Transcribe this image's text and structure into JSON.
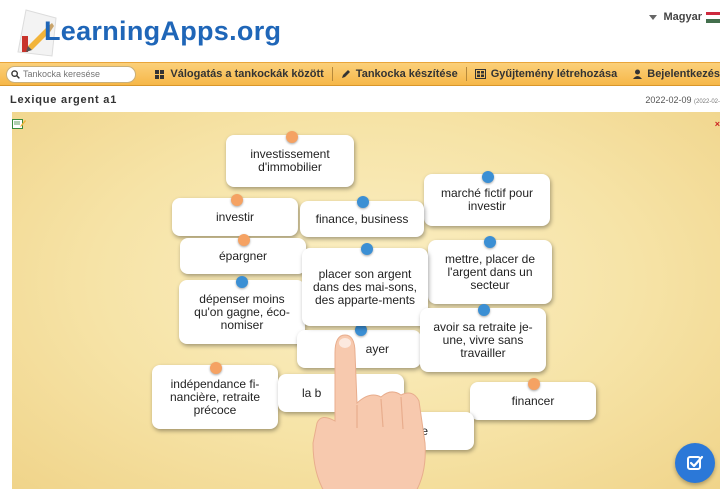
{
  "header": {
    "logo_text": "LearningApps.org",
    "language": "Magyar",
    "flag_colors": [
      "#cd2a3e",
      "#ffffff",
      "#436f4d"
    ]
  },
  "nav": {
    "search_placeholder": "Tankocka keresése",
    "items": [
      {
        "icon": "grid-icon",
        "label": "Válogatás a tankockák között"
      },
      {
        "icon": "pencil-icon",
        "label": "Tankocka készítése"
      },
      {
        "icon": "collection-icon",
        "label": "Gyűjtemény létrehozása"
      },
      {
        "icon": "user-icon",
        "label": "Bejelentkezés"
      }
    ]
  },
  "app": {
    "title": "Lexique argent a1",
    "date": "2022-02-09",
    "date_small": "(2022-02-"
  },
  "cards": [
    {
      "text": "investissement d'immobilier",
      "pin": "orange"
    },
    {
      "text": "marché fictif pour investir",
      "pin": "blue"
    },
    {
      "text": "investir",
      "pin": "orange"
    },
    {
      "text": "finance, business",
      "pin": "blue"
    },
    {
      "text": "épargner",
      "pin": "orange"
    },
    {
      "text": "mettre, placer de l'argent dans un secteur",
      "pin": "blue"
    },
    {
      "text": "placer son argent dans des mai-sons, des apparte-ments",
      "pin": "blue"
    },
    {
      "text": "dépenser moins qu'on gagne, éco-nomiser",
      "pin": "blue"
    },
    {
      "text": "ayer",
      "pin": "blue"
    },
    {
      "text": "avoir sa retraite je-une, vivre sans travailler",
      "pin": "blue"
    },
    {
      "text": "indépendance fi-nancière, retraite précoce",
      "pin": "orange"
    },
    {
      "text": "la b",
      "pin": "none"
    },
    {
      "text": "financer",
      "pin": "orange"
    },
    {
      "text": "ire",
      "pin": "orange"
    }
  ],
  "colors": {
    "accent": "#f6b748",
    "logo_blue": "#1f66b8",
    "pin_orange": "#f5a263",
    "pin_blue": "#3b8fd4",
    "check_button": "#2b78d8"
  }
}
